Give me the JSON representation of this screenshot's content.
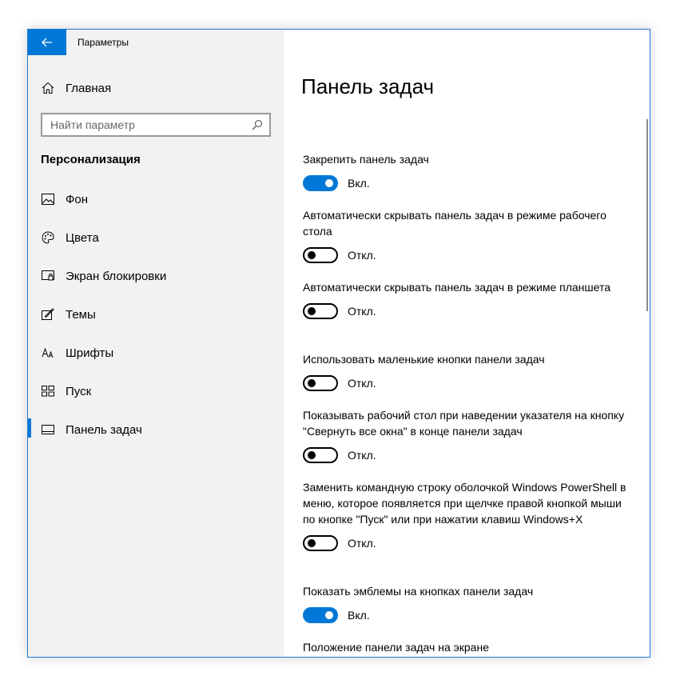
{
  "window": {
    "title": "Параметры",
    "accent_color": "#0078d7"
  },
  "sidebar": {
    "home_label": "Главная",
    "search_placeholder": "Найти параметр",
    "section_title": "Персонализация",
    "items": [
      {
        "label": "Фон",
        "icon": "picture-icon"
      },
      {
        "label": "Цвета",
        "icon": "palette-icon"
      },
      {
        "label": "Экран блокировки",
        "icon": "lock-screen-icon"
      },
      {
        "label": "Темы",
        "icon": "themes-icon"
      },
      {
        "label": "Шрифты",
        "icon": "fonts-icon"
      },
      {
        "label": "Пуск",
        "icon": "start-icon"
      },
      {
        "label": "Панель задач",
        "icon": "taskbar-icon",
        "active": true
      }
    ]
  },
  "main": {
    "title": "Панель задач",
    "settings": [
      {
        "label": "Закрепить панель задач",
        "state": "on",
        "state_label": "Вкл."
      },
      {
        "label": "Автоматически скрывать панель задач в режиме рабочего стола",
        "state": "off",
        "state_label": "Откл."
      },
      {
        "label": "Автоматически скрывать панель задач в режиме планшета",
        "state": "off",
        "state_label": "Откл."
      },
      {
        "label": "Использовать маленькие кнопки панели задач",
        "state": "off",
        "state_label": "Откл."
      },
      {
        "label": "Показывать рабочий стол при наведении указателя на кнопку \"Свернуть все окна\" в конце панели задач",
        "state": "off",
        "state_label": "Откл."
      },
      {
        "label": "Заменить командную строку оболочкой Windows PowerShell в меню, которое появляется при щелчке правой кнопкой мыши по кнопке \"Пуск\" или при нажатии клавиш Windows+X",
        "state": "off",
        "state_label": "Откл."
      },
      {
        "label": "Показать эмблемы на кнопках панели задач",
        "state": "on",
        "state_label": "Вкл."
      }
    ],
    "last_section_label": "Положение панели задач на экране"
  }
}
